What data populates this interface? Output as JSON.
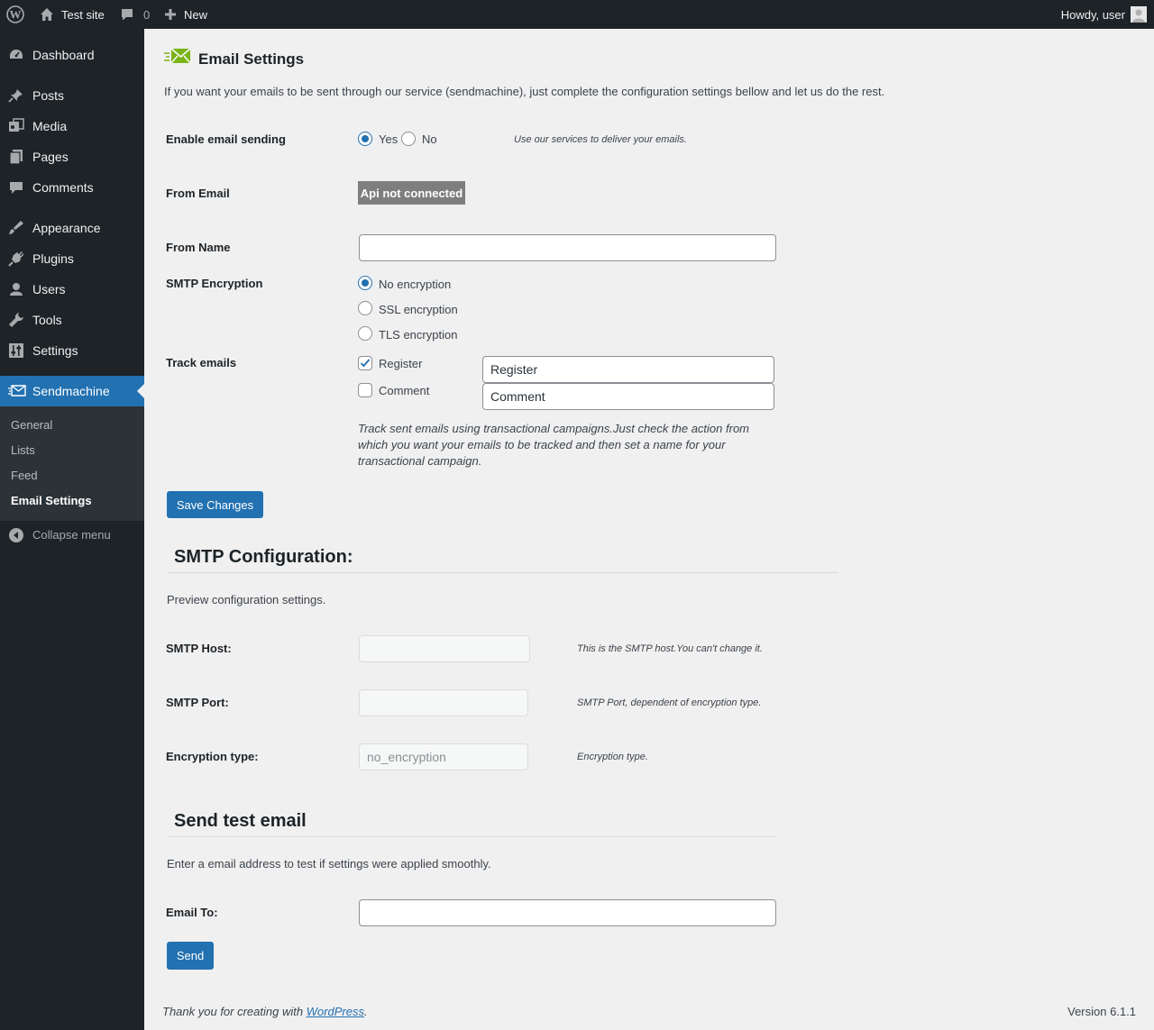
{
  "admin_bar": {
    "site_name": "Test site",
    "comments_count": "0",
    "new_label": "New",
    "howdy": "Howdy, user"
  },
  "sidebar": {
    "items": [
      {
        "label": "Dashboard",
        "icon": "dashboard-icon"
      },
      {
        "label": "Posts",
        "icon": "pin-icon"
      },
      {
        "label": "Media",
        "icon": "media-icon"
      },
      {
        "label": "Pages",
        "icon": "pages-icon"
      },
      {
        "label": "Comments",
        "icon": "comment-icon"
      },
      {
        "label": "Appearance",
        "icon": "brush-icon"
      },
      {
        "label": "Plugins",
        "icon": "plug-icon"
      },
      {
        "label": "Users",
        "icon": "user-icon"
      },
      {
        "label": "Tools",
        "icon": "wrench-icon"
      },
      {
        "label": "Settings",
        "icon": "sliders-icon"
      },
      {
        "label": "Sendmachine",
        "icon": "sendmachine-icon"
      }
    ],
    "submenu": [
      "General",
      "Lists",
      "Feed",
      "Email Settings"
    ],
    "collapse_label": "Collapse menu"
  },
  "page": {
    "title": "Email Settings",
    "intro": "If you want your emails to be sent through our service (sendmachine), just complete the configuration settings bellow and let us do the rest.",
    "enable_label": "Enable email sending",
    "yes_label": "Yes",
    "no_label": "No",
    "enable_desc": "Use our services to deliver your emails.",
    "from_email_label": "From Email",
    "api_status": "Api not connected",
    "from_name_label": "From Name",
    "from_name_value": "",
    "smtp_enc_label": "SMTP Encryption",
    "enc_options": [
      "No encryption",
      "SSL encryption",
      "TLS encryption"
    ],
    "track_label": "Track emails",
    "track_register_label": "Register",
    "track_comment_label": "Comment",
    "track_register_value": "Register",
    "track_comment_value": "Comment",
    "track_desc": "Track sent emails using transactional campaigns.Just check the action from which you want your emails to be tracked and then set a name for your transactional campaign.",
    "save_label": "Save Changes"
  },
  "smtp": {
    "title": "SMTP Configuration:",
    "intro": "Preview configuration settings.",
    "host_label": "SMTP Host:",
    "host_value": "",
    "host_desc": "This is the SMTP host.You can't change it.",
    "port_label": "SMTP Port:",
    "port_value": "",
    "port_desc": "SMTP Port, dependent of encryption type.",
    "enc_label": "Encryption type:",
    "enc_value": "no_encryption",
    "enc_desc": "Encryption type."
  },
  "test": {
    "title": "Send test email",
    "intro": "Enter a email address to test if settings were applied smoothly.",
    "email_label": "Email To:",
    "email_value": "",
    "send_label": "Send"
  },
  "footer": {
    "thanks_prefix": "Thank you for creating with ",
    "link_text": "WordPress",
    "thanks_suffix": ".",
    "version": "Version 6.1.1"
  },
  "colors": {
    "accent": "#2271b1",
    "sidebar_bg": "#1d2327",
    "badge_bg": "#7e7e7e"
  }
}
